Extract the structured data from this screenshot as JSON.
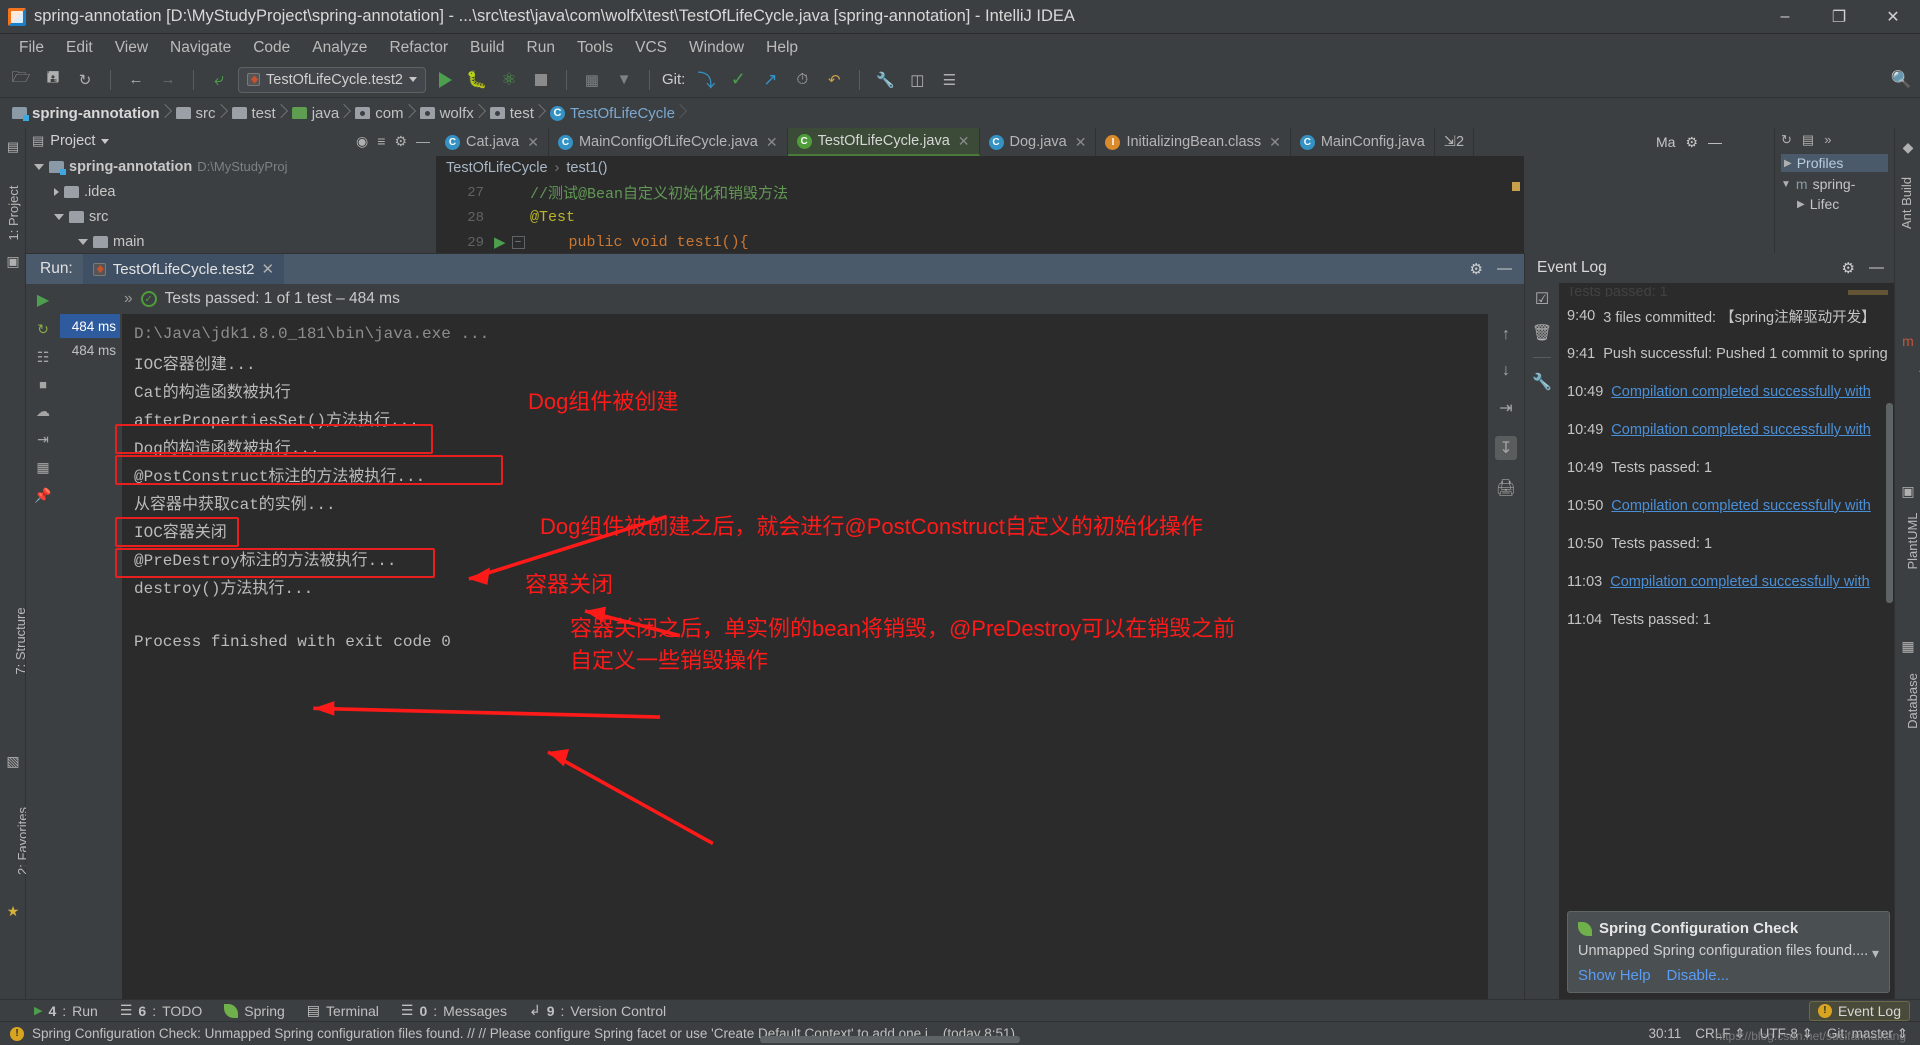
{
  "window": {
    "title": "spring-annotation [D:\\MyStudyProject\\spring-annotation] - ...\\src\\test\\java\\com\\wolfx\\test\\TestOfLifeCycle.java [spring-annotation] - IntelliJ IDEA",
    "minimize": "–",
    "maximize": "❐",
    "close": "✕"
  },
  "menu": [
    "File",
    "Edit",
    "View",
    "Navigate",
    "Code",
    "Analyze",
    "Refactor",
    "Build",
    "Run",
    "Tools",
    "VCS",
    "Window",
    "Help"
  ],
  "toolbar": {
    "run_config": "TestOfLifeCycle.test2",
    "git_label": "Git:",
    "icons": [
      "open-folder-icon",
      "save-all-icon",
      "sync-icon",
      "back-arrow-icon",
      "forward-arrow-icon",
      "undo-arrow-icon",
      "run-icon",
      "debug-icon",
      "run-coverage-icon",
      "stop-icon",
      "profile-icon",
      "attach-icon",
      "vcs-update-icon",
      "vcs-commit-icon",
      "vcs-push-icon",
      "history-icon",
      "rollback-icon",
      "settings-wrench-icon",
      "diff-icon",
      "structure-icon",
      "search-everywhere-icon"
    ]
  },
  "breadcrumb": [
    {
      "label": "spring-annotation",
      "icon": "project-folder-icon"
    },
    {
      "label": "src",
      "icon": "folder-icon"
    },
    {
      "label": "test",
      "icon": "folder-icon"
    },
    {
      "label": "java",
      "icon": "source-folder-icon"
    },
    {
      "label": "com",
      "icon": "package-icon"
    },
    {
      "label": "wolfx",
      "icon": "package-icon"
    },
    {
      "label": "test",
      "icon": "package-icon"
    },
    {
      "label": "TestOfLifeCycle",
      "icon": "class-icon"
    }
  ],
  "project_panel": {
    "title": "Project",
    "tree": [
      {
        "label": "spring-annotation",
        "detail": "D:\\MyStudyProj",
        "depth": 0,
        "expanded": true,
        "icon": "module-icon"
      },
      {
        "label": ".idea",
        "detail": "",
        "depth": 1,
        "expanded": false,
        "icon": "folder-icon"
      },
      {
        "label": "src",
        "detail": "",
        "depth": 1,
        "expanded": true,
        "icon": "folder-icon"
      },
      {
        "label": "main",
        "detail": "",
        "depth": 2,
        "expanded": true,
        "icon": "folder-icon"
      }
    ]
  },
  "editor": {
    "tabs": [
      {
        "label": "Cat.java",
        "icon": "class-icon",
        "active": false
      },
      {
        "label": "MainConfigOfLifeCycle.java",
        "icon": "class-icon",
        "active": false
      },
      {
        "label": "TestOfLifeCycle.java",
        "icon": "test-class-icon",
        "active": true
      },
      {
        "label": "Dog.java",
        "icon": "class-icon",
        "active": false
      },
      {
        "label": "InitializingBean.class",
        "icon": "interface-icon",
        "active": false
      },
      {
        "label": "MainConfig.java",
        "icon": "class-icon",
        "active": false
      }
    ],
    "tab_overflow": "⇲2",
    "breadcrumb": [
      "TestOfLifeCycle",
      "test1()"
    ],
    "lines": [
      {
        "num": "27",
        "text": "    //测试@Bean自定义初始化和销毁方法",
        "kind": "comment"
      },
      {
        "num": "28",
        "text": "    @Test",
        "kind": "annotation"
      },
      {
        "num": "29",
        "text": "    public void test1(){",
        "kind": "code"
      }
    ]
  },
  "run_panel": {
    "label": "Run:",
    "tab": "TestOfLifeCycle.test2",
    "tests_status": "Tests passed: 1 of 1 test – 484 ms",
    "tests_chevron": "»",
    "times": [
      "484 ms",
      "484 ms"
    ],
    "console": [
      {
        "text": "D:\\Java\\jdk1.8.0_181\\bin\\java.exe ...",
        "dim": true
      },
      {
        "text": "IOC容器创建...",
        "dim": false
      },
      {
        "text": "Cat的构造函数被执行",
        "dim": false
      },
      {
        "text": "afterPropertiesSet()方法执行...",
        "dim": false
      },
      {
        "text": "Dog的构造函数被执行...",
        "dim": false
      },
      {
        "text": "@PostConstruct标注的方法被执行...",
        "dim": false
      },
      {
        "text": "从容器中获取cat的实例...",
        "dim": false
      },
      {
        "text": "IOC容器关闭",
        "dim": false
      },
      {
        "text": "@PreDestroy标注的方法被执行...",
        "dim": false
      },
      {
        "text": "destroy()方法执行...",
        "dim": false
      },
      {
        "text": "",
        "dim": false
      },
      {
        "text": "Process finished with exit code 0",
        "dim": false
      }
    ],
    "gutter_icons": [
      "rerun-icon",
      "rerun-failed-icon",
      "toggle-tests-icon",
      "stop-icon",
      "screenshot-icon",
      "export-icon",
      "grid-icon",
      "pin-icon"
    ],
    "side_icons": [
      "scroll-up-icon",
      "scroll-down-icon",
      "soft-wrap-icon",
      "scroll-to-end-icon",
      "print-icon"
    ]
  },
  "annotations": {
    "accent_color": "#ff1a1a",
    "items": [
      {
        "text": "Dog组件被创建"
      },
      {
        "text": "Dog组件被创建之后，就会进行@PostConstruct自定义的初始化操作"
      },
      {
        "text": "容器关闭"
      },
      {
        "text": "容器关闭之后，单实例的bean将销毁，@PreDestroy可以在销毁之前"
      },
      {
        "text": "自定义一些销毁操作"
      }
    ]
  },
  "event_log": {
    "title": "Event Log",
    "rows": [
      {
        "time": "9:40",
        "text": "3 files committed: 【spring注解驱动开发】",
        "link": ""
      },
      {
        "time": "9:41",
        "text": "Push successful: Pushed 1 commit to spring",
        "link": ""
      },
      {
        "time": "10:49",
        "text": "",
        "link": "Compilation completed successfully with"
      },
      {
        "time": "10:49",
        "text": "",
        "link": "Compilation completed successfully with"
      },
      {
        "time": "10:49",
        "text": "Tests passed: 1",
        "link": ""
      },
      {
        "time": "10:50",
        "text": "",
        "link": "Compilation completed successfully with"
      },
      {
        "time": "10:50",
        "text": "Tests passed: 1",
        "link": ""
      },
      {
        "time": "11:03",
        "text": "",
        "link": "Compilation completed successfully with"
      },
      {
        "time": "11:04",
        "text": "Tests passed: 1",
        "link": ""
      }
    ],
    "balloon": {
      "title": "Spring Configuration Check",
      "message": "Unmapped Spring configuration files found....",
      "actions": [
        "Show Help",
        "Disable..."
      ]
    },
    "gutter_icons": [
      "mark-read-icon",
      "delete-icon",
      "settings-wrench-icon"
    ]
  },
  "right_rail": [
    "Ant Build",
    "Maven Projects",
    "PlantUML",
    "Database"
  ],
  "left_rail": [
    "1: Project",
    "7: Structure",
    "2: Favorites"
  ],
  "bottom_bar": {
    "windows": [
      {
        "num": "4",
        "label": "Run",
        "icon": "run-icon"
      },
      {
        "num": "6",
        "label": "TODO",
        "icon": "todo-icon"
      },
      {
        "num": "",
        "label": "Spring",
        "icon": "spring-leaf-icon"
      },
      {
        "num": "",
        "label": "Terminal",
        "icon": "terminal-icon"
      },
      {
        "num": "0",
        "label": "Messages",
        "icon": "messages-icon"
      },
      {
        "num": "9",
        "label": "Version Control",
        "icon": "vcs-icon"
      }
    ],
    "event_log_button": "Event Log"
  },
  "status_bar": {
    "message": "Spring Configuration Check: Unmapped Spring configuration files found. // // Please configure Spring facet or use 'Create Default Context' to add one i... (today 8:51)",
    "caret": "30:11",
    "line_sep": "CRLF",
    "encoding": "UTF-8",
    "branch": "Git: master",
    "watermark": "https://blog.csdn.net/sucifanhaikang"
  },
  "right_panel_peek": {
    "items": [
      "Profiles",
      "spring-",
      "Lifec"
    ]
  }
}
